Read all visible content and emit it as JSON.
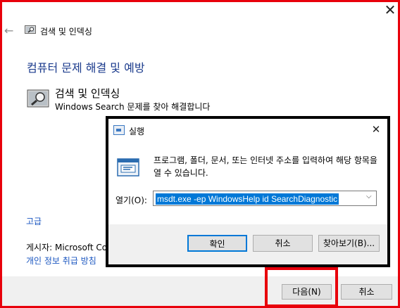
{
  "window": {
    "title": "검색 및 인덱싱",
    "close_glyph": "✕",
    "back_glyph": "←"
  },
  "main": {
    "heading": "컴퓨터 문제 해결 및 예방",
    "problem": {
      "title": "검색 및 인덱싱",
      "description": "Windows Search 문제를 찾아 해결합니다"
    },
    "advanced_link": "고급",
    "publisher": "게시자:  Microsoft Co",
    "privacy_link": "개인 정보 취급 방침"
  },
  "footer": {
    "next_label": "다음(N)",
    "cancel_label": "취소"
  },
  "run_dialog": {
    "title": "실행",
    "close_glyph": "✕",
    "description": "프로그램, 폴더, 문서, 또는 인터넷 주소를 입력하여 해당 항목을 열 수 있습니다.",
    "open_label": "열기(O):",
    "open_value": "msdt.exe -ep WindowsHelp id SearchDiagnostic",
    "combo_arrow": "⌵",
    "ok_label": "확인",
    "cancel_label": "취소",
    "browse_label": "찾아보기(B)..."
  },
  "colors": {
    "highlight_red": "#e8000b",
    "heading_blue": "#1a3a8c",
    "link_blue": "#1a56c0",
    "selection_blue": "#0078d7"
  },
  "icons": [
    "back-arrow-icon",
    "search-indexing-icon",
    "run-icon",
    "dropdown-arrow-icon",
    "close-icon"
  ]
}
